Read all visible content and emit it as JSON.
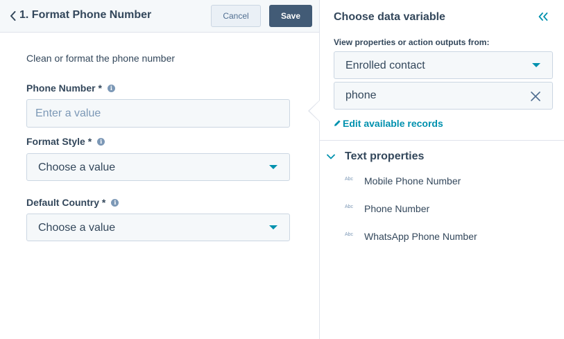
{
  "header": {
    "title": "1. Format Phone Number",
    "cancel_label": "Cancel",
    "save_label": "Save"
  },
  "action": {
    "description": "Clean or format the phone number",
    "fields": [
      {
        "label": "Phone Number *",
        "type": "text",
        "placeholder": "Enter a value",
        "value": ""
      },
      {
        "label": "Format Style *",
        "type": "select",
        "value": "Choose a value"
      },
      {
        "label": "Default Country *",
        "type": "select",
        "value": "Choose a value"
      }
    ]
  },
  "variable_panel": {
    "title": "Choose data variable",
    "view_label": "View properties or action outputs from:",
    "source_value": "Enrolled contact",
    "search_value": "phone",
    "edit_link": "Edit available records",
    "section_title": "Text properties",
    "type_badge": "Abc",
    "properties": [
      "Mobile Phone Number",
      "Phone Number",
      "WhatsApp Phone Number"
    ]
  },
  "icons": {
    "back": "chevron-left-icon",
    "info": "info-icon",
    "collapse": "double-chevron-left-icon",
    "clear": "close-icon",
    "edit": "pencil-icon",
    "section_toggle": "chevron-down-icon",
    "dropdown": "caret-down-icon"
  },
  "colors": {
    "accent": "#0091ae",
    "primary_button": "#425b76",
    "text": "#33475b",
    "input_bg": "#f5f8fa",
    "border": "#cbd6e2"
  }
}
